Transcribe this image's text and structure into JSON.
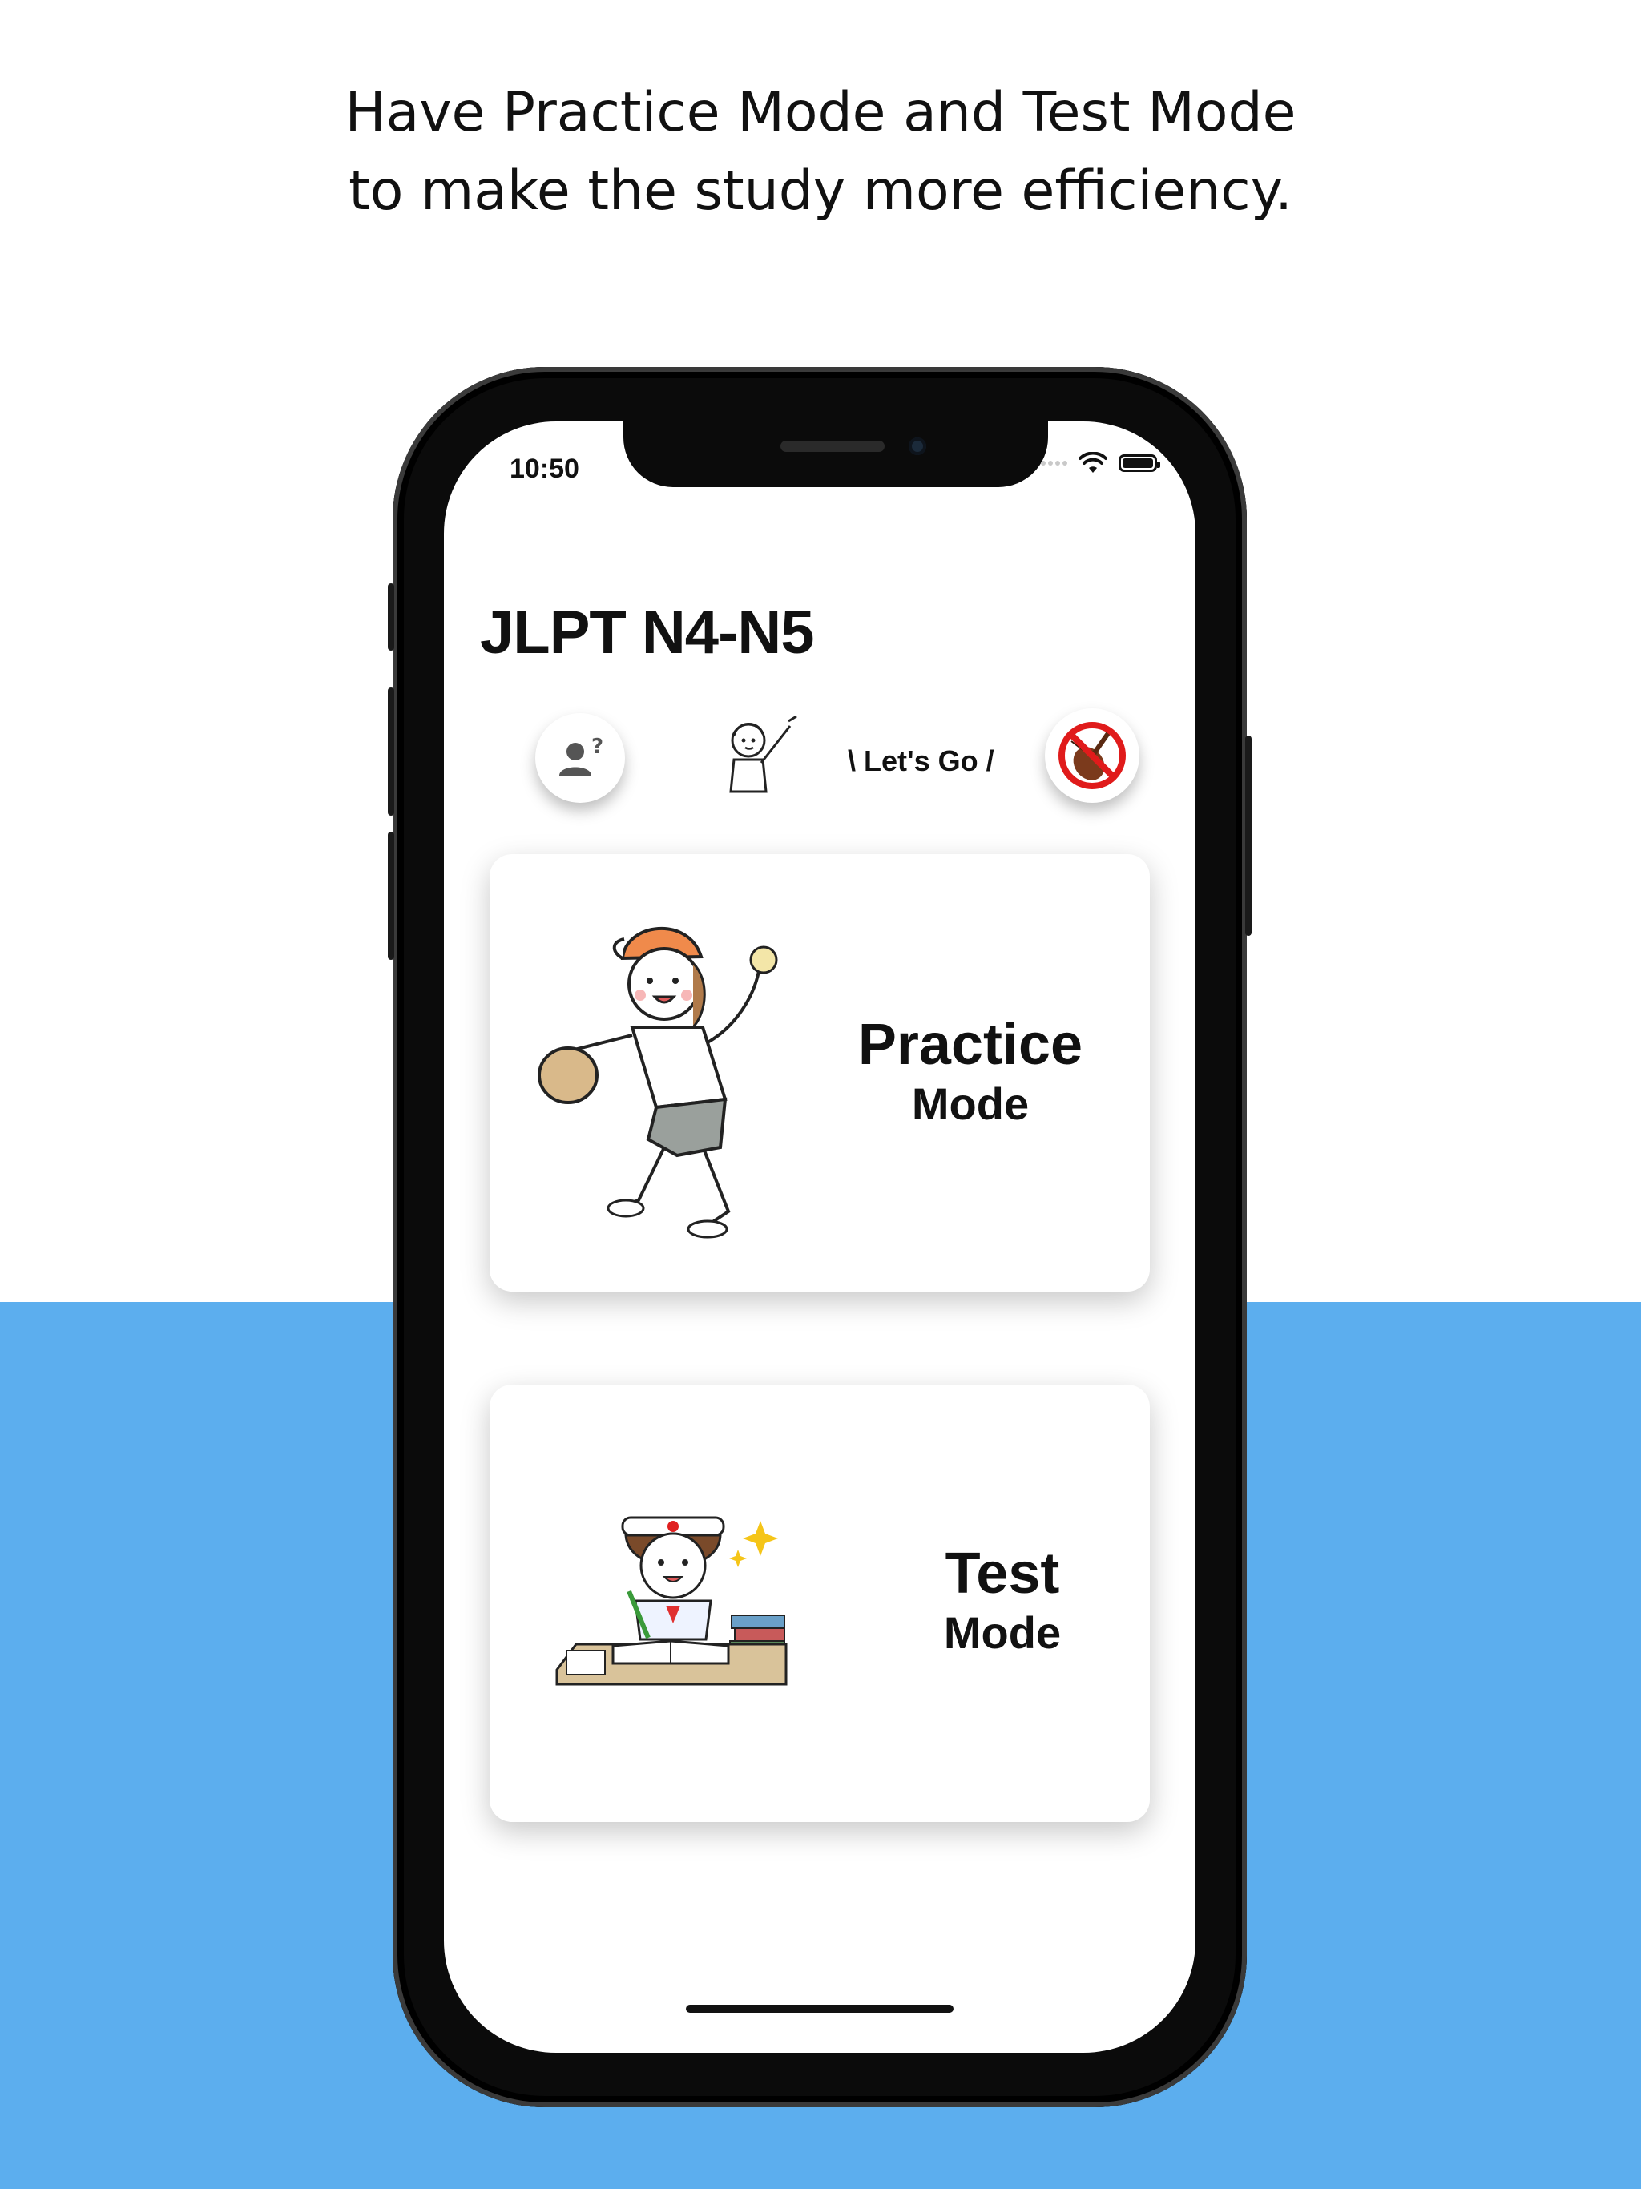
{
  "banner": {
    "line1": "Have Practice Mode and Test Mode",
    "line2": "to make the study more efficiency."
  },
  "status_bar": {
    "time": "10:50",
    "icons": [
      "signal-dots-icon",
      "wifi-icon",
      "battery-icon"
    ]
  },
  "app": {
    "title": "JLPT N4-N5",
    "lets_go": "\\ Let's Go /",
    "profile_icon": "user-question-icon",
    "sound_icon": "no-music-violin-icon"
  },
  "cards": [
    {
      "title": "Practice",
      "subtitle": "Mode",
      "illustration": "baseball-player-illustration"
    },
    {
      "title": "Test",
      "subtitle": "Mode",
      "illustration": "student-studying-illustration"
    }
  ],
  "colors": {
    "background_accent": "#5caeee",
    "text": "#111111",
    "phone_frame": "#0b0b0b"
  }
}
